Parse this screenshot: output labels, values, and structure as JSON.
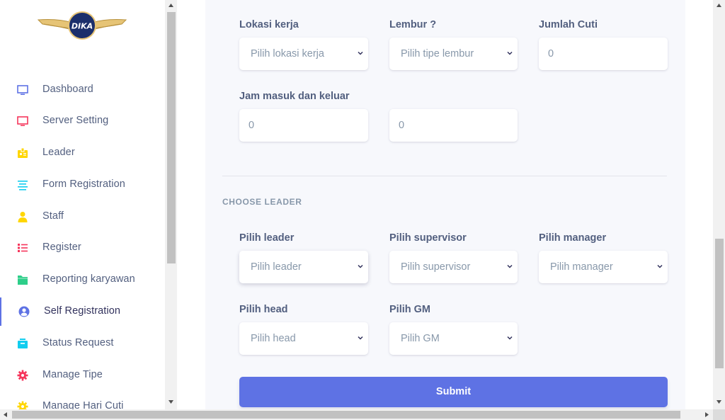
{
  "brand": {
    "logo_text": "DIKA",
    "accent": "#5e72e4"
  },
  "sidebar": {
    "items": [
      {
        "label": "Dashboard",
        "icon": "monitor-icon",
        "color": "#5e72e4"
      },
      {
        "label": "Server Setting",
        "icon": "monitor-icon",
        "color": "#f5365c"
      },
      {
        "label": "Leader",
        "icon": "badge-icon",
        "color": "#ffd600"
      },
      {
        "label": "Form Registration",
        "icon": "align-center-icon",
        "color": "#11cdef"
      },
      {
        "label": "Staff",
        "icon": "user-icon",
        "color": "#ffd600"
      },
      {
        "label": "Register",
        "icon": "list-icon",
        "color": "#f5365c"
      },
      {
        "label": "Reporting karyawan",
        "icon": "folder-icon",
        "color": "#2dce89"
      },
      {
        "label": "Self Registration",
        "icon": "user-circle-icon",
        "color": "#5e72e4"
      },
      {
        "label": "Status Request",
        "icon": "archive-icon",
        "color": "#11cdef"
      },
      {
        "label": "Manage Tipe",
        "icon": "gear-icon",
        "color": "#f5365c"
      },
      {
        "label": "Manage Hari Cuti",
        "icon": "gear-icon",
        "color": "#ffd600"
      }
    ]
  },
  "form": {
    "lokasi": {
      "label": "Lokasi kerja",
      "placeholder": "Pilih lokasi kerja"
    },
    "lembur": {
      "label": "Lembur ?",
      "placeholder": "Pilih tipe lembur"
    },
    "cuti": {
      "label": "Jumlah Cuti",
      "value": "0"
    },
    "jam": {
      "label": "Jam masuk dan keluar",
      "masuk": "0",
      "keluar": "0"
    },
    "section_title": "CHOOSE LEADER",
    "leader": {
      "label": "Pilih leader",
      "placeholder": "Pilih leader"
    },
    "supervisor": {
      "label": "Pilih supervisor",
      "placeholder": "Pilih supervisor"
    },
    "manager": {
      "label": "Pilih manager",
      "placeholder": "Pilih manager"
    },
    "head": {
      "label": "Pilih head",
      "placeholder": "Pilih head"
    },
    "gm": {
      "label": "Pilih GM",
      "placeholder": "Pilih GM"
    },
    "submit_label": "Submit"
  }
}
